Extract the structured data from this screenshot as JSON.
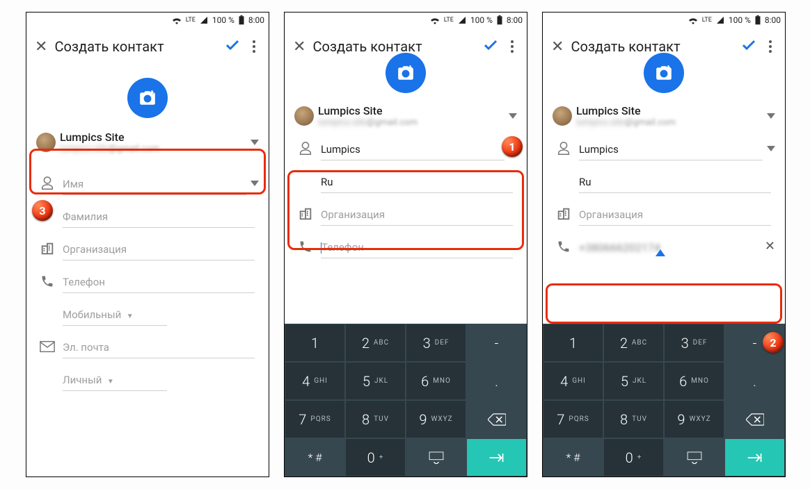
{
  "status": {
    "net": "LTE",
    "battery_pct": "100 %",
    "time": "8:00"
  },
  "header": {
    "title": "Создать контакт"
  },
  "account": {
    "name": "Lumpics Site",
    "email_suffix": "@gmail.com"
  },
  "fields": {
    "first_name_ph": "Имя",
    "last_name_ph": "Фамилия",
    "org_ph": "Организация",
    "phone_ph": "Телефон",
    "mobile_type": "Мобильный",
    "email_ph": "Эл. почта",
    "personal_type": "Личный",
    "first_name_val": "Lumpics",
    "last_name_val": "Ru"
  },
  "keypad": {
    "rows": [
      [
        "1",
        "",
        "2",
        "ABC",
        "3",
        "DEF",
        "⌫"
      ],
      [
        "4",
        "GHI",
        "5",
        "JKL",
        "6",
        "MNO",
        "."
      ],
      [
        "7",
        "PQRS",
        "8",
        "TUV",
        "9",
        "WXYZ",
        "⌫"
      ],
      [
        "* #",
        "",
        "0",
        "+",
        "↓",
        "",
        "→"
      ]
    ]
  },
  "badges": {
    "b1": "1",
    "b2": "2",
    "b3": "3"
  }
}
